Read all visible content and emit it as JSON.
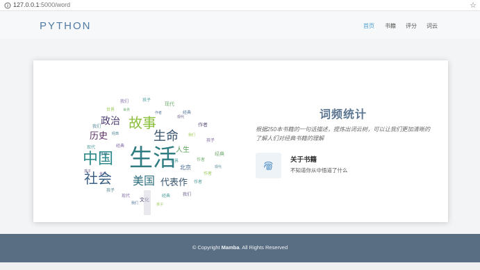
{
  "browser": {
    "url_host": "127.0.0.1",
    "url_port_path": ":5000/word"
  },
  "navbar": {
    "brand": "PYTHON",
    "links": [
      {
        "label": "首页",
        "active": true
      },
      {
        "label": "书籍",
        "active": false
      },
      {
        "label": "评分",
        "active": false
      },
      {
        "label": "词云",
        "active": false
      }
    ]
  },
  "wordcloud": {
    "words": [
      "中国",
      "生活",
      "社会",
      "美国",
      "故事",
      "生命",
      "政治",
      "历史",
      "代表作",
      "人生",
      "北京",
      "文化",
      "我们",
      "孩子",
      "现代",
      "经典",
      "世界",
      "作者"
    ]
  },
  "section": {
    "title": "词频统计",
    "description": "根据250本书籍的一句话描述，提炼出词云树，可以让我们更加清晰的了解人们对经典书籍的理解",
    "feature_title": "关于书籍",
    "feature_text": "不知道你从中悟道了什么",
    "feature_icon": "fingerprint-icon"
  },
  "footer": {
    "prefix": "© Copyright ",
    "name": "Mamba",
    "suffix": ". All Rights Reserved"
  },
  "colors": {
    "brand": "#4f7aa3",
    "nav_active": "#4a9fd3",
    "footer_bg": "#5a6e83",
    "title": "#5c7691"
  }
}
